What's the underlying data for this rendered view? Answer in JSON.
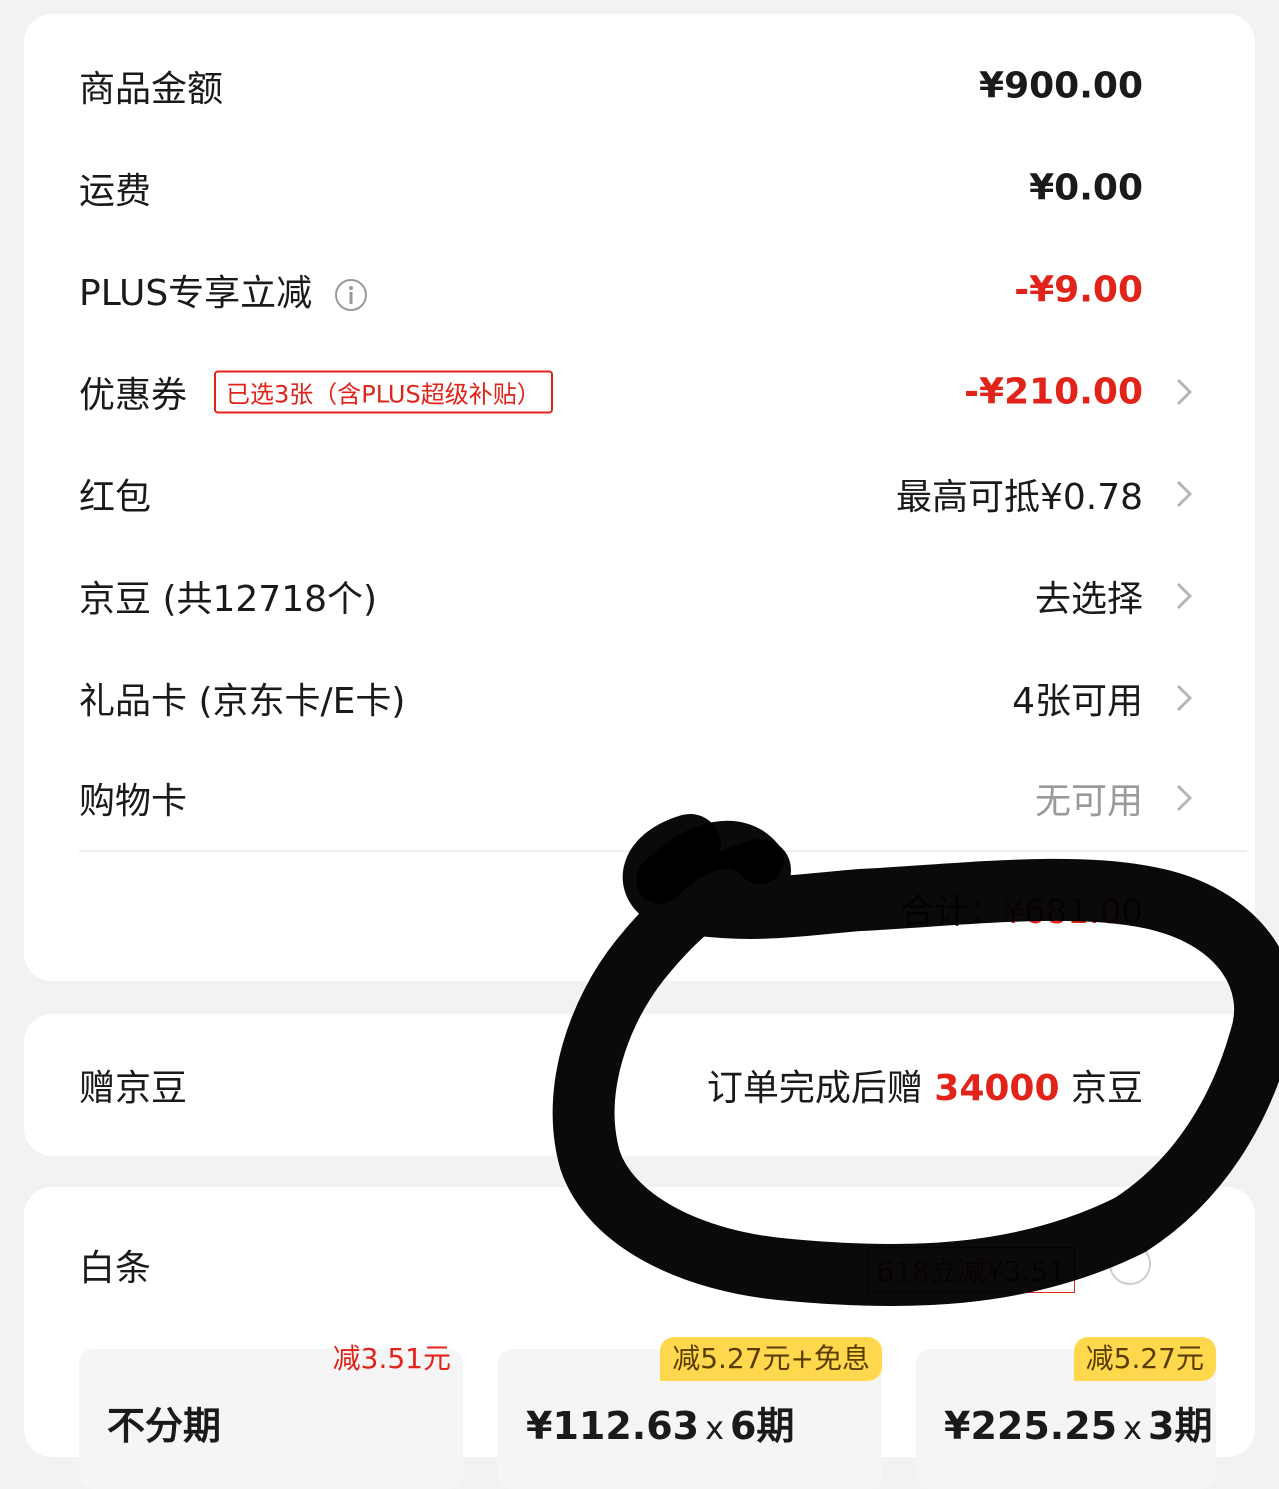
{
  "summary": {
    "rows": [
      {
        "label": "商品金额",
        "value": "¥900.00"
      },
      {
        "label": "运费",
        "value": "¥0.00"
      },
      {
        "label": "PLUS专享立减",
        "value": "-¥9.00"
      },
      {
        "label": "优惠券",
        "badge": "已选3张（含PLUS超级补贴）",
        "value": "-¥210.00"
      },
      {
        "label": "红包",
        "value": "最高可抵¥0.78"
      },
      {
        "label": "京豆 (共12718个)",
        "value": "去选择"
      },
      {
        "label": "礼品卡 (京东卡/E卡)",
        "value": "4张可用"
      },
      {
        "label": "购物卡",
        "value": "无可用"
      }
    ],
    "total_label": "合计：",
    "total_amount": "¥681.00"
  },
  "beans": {
    "label": "赠京豆",
    "value_prefix": "订单完成后赠",
    "value_amount": "34000",
    "value_suffix": "京豆"
  },
  "baitiao": {
    "title": "白条",
    "promo": "618立减¥3.51",
    "plans": [
      {
        "tag": "减3.51元",
        "text": "不分期"
      },
      {
        "tag": "减5.27元+免息",
        "price": "¥112.63",
        "x": "x",
        "period": "6期"
      },
      {
        "tag": "减5.27元",
        "price": "¥225.25",
        "x": "x",
        "period": "3期"
      }
    ]
  },
  "colors": {
    "accent_red": "#e2231a",
    "tag_yellow": "#ffd84d",
    "background": "#f2f2f2",
    "marker": "#000000"
  },
  "icons": {
    "info": "info-circle-icon",
    "chevron": "chevron-right-icon"
  }
}
